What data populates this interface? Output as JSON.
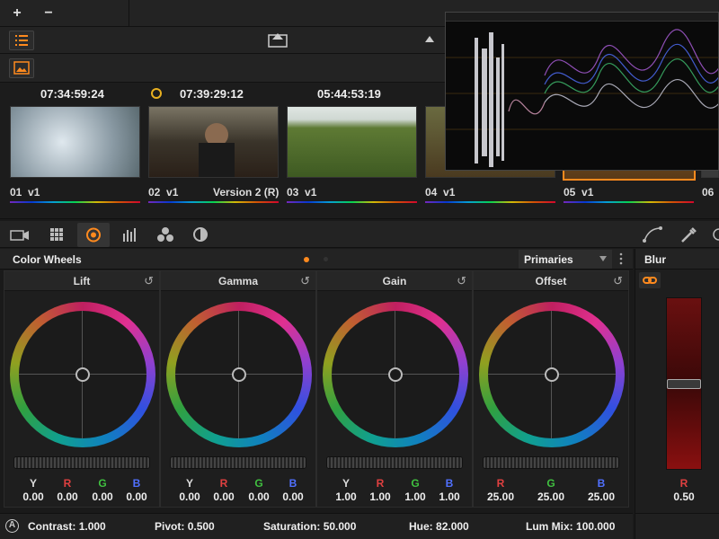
{
  "toolbar": {
    "add_label": "+",
    "remove_label": "−"
  },
  "clips": [
    {
      "timecode": "07:34:59:24",
      "number": "01",
      "track": "v1",
      "version": "",
      "thumb_color": "#9aa8b0"
    },
    {
      "timecode": "07:39:29:12",
      "number": "02",
      "track": "v1",
      "version": "Version 2 (R)",
      "thumb_color": "#4a4438"
    },
    {
      "timecode": "05:44:53:19",
      "number": "03",
      "track": "v1",
      "version": "",
      "thumb_color": "#4d6b2a"
    },
    {
      "timecode": "",
      "number": "04",
      "track": "v1",
      "version": "",
      "thumb_color": "#5a5030"
    },
    {
      "timecode": "",
      "number": "05",
      "track": "v1",
      "version": "",
      "thumb_color": "#6a4a20"
    },
    {
      "timecode": "",
      "number": "06",
      "track": "",
      "version": "",
      "thumb_color": "#333"
    }
  ],
  "color_wheels": {
    "title": "Color Wheels",
    "mode": "Primaries",
    "wheels": [
      {
        "name": "Lift",
        "channels": [
          "Y",
          "R",
          "G",
          "B"
        ],
        "values": [
          "0.00",
          "0.00",
          "0.00",
          "0.00"
        ]
      },
      {
        "name": "Gamma",
        "channels": [
          "Y",
          "R",
          "G",
          "B"
        ],
        "values": [
          "0.00",
          "0.00",
          "0.00",
          "0.00"
        ]
      },
      {
        "name": "Gain",
        "channels": [
          "Y",
          "R",
          "G",
          "B"
        ],
        "values": [
          "1.00",
          "1.00",
          "1.00",
          "1.00"
        ]
      },
      {
        "name": "Offset",
        "channels": [
          "R",
          "G",
          "B"
        ],
        "values": [
          "25.00",
          "25.00",
          "25.00"
        ]
      }
    ]
  },
  "blur": {
    "title": "Blur",
    "channel": "R",
    "value": "0.50"
  },
  "adjustments": {
    "contrast_label": "Contrast:",
    "contrast": "1.000",
    "pivot_label": "Pivot:",
    "pivot": "0.500",
    "saturation_label": "Saturation:",
    "saturation": "50.000",
    "hue_label": "Hue:",
    "hue": "82.000",
    "lummix_label": "Lum Mix:",
    "lummix": "100.000"
  },
  "colors": {
    "accent": "#ff8a1e",
    "panel_bg": "#1e1e1e"
  }
}
